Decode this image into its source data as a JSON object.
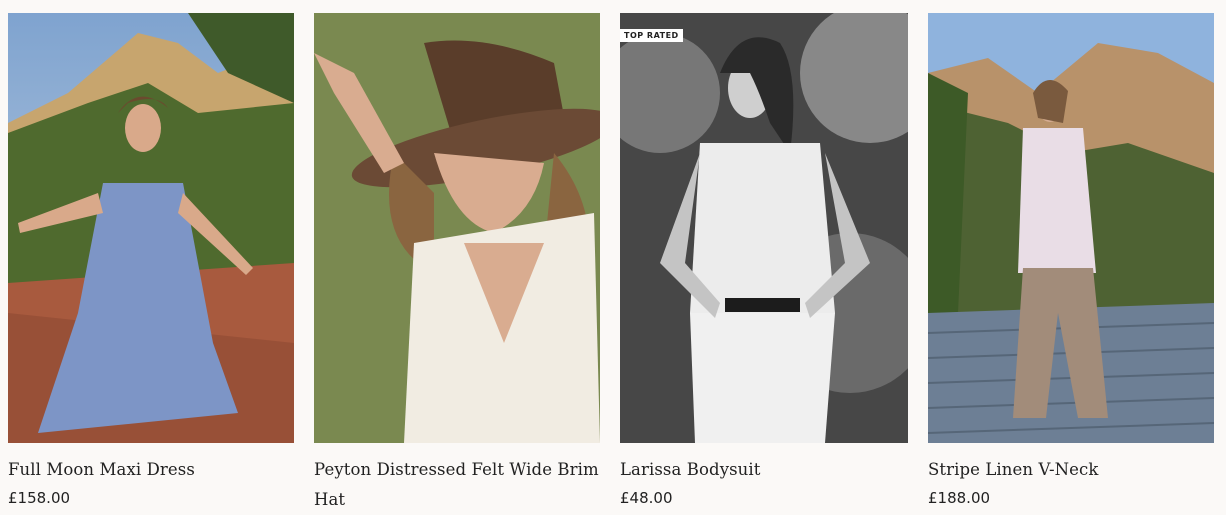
{
  "products": [
    {
      "name": "Full Moon Maxi Dress",
      "price": "£158.00",
      "badge": "",
      "image_desc_icon": "product-photo"
    },
    {
      "name": "Peyton Distressed Felt Wide Brim Hat",
      "price": "",
      "badge": "",
      "image_desc_icon": "product-photo"
    },
    {
      "name": "Larissa Bodysuit",
      "price": "£48.00",
      "badge": "TOP RATED",
      "image_desc_icon": "product-photo"
    },
    {
      "name": "Stripe Linen V-Neck",
      "price": "£188.00",
      "badge": "",
      "image_desc_icon": "product-photo"
    }
  ],
  "colors": {
    "background": "#fbf9f7",
    "text": "#222222",
    "badge_bg": "#ffffff"
  }
}
